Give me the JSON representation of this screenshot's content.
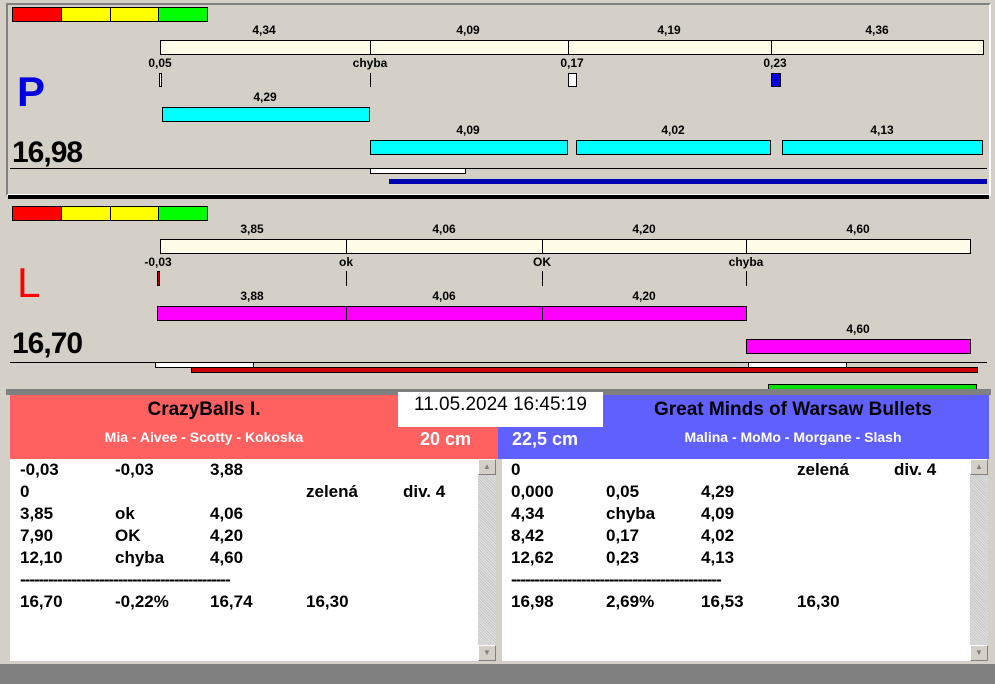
{
  "colors": {
    "red": "#ff0000",
    "yellow": "#ffff00",
    "green": "#00ff00",
    "cyan": "#00ffff",
    "magenta": "#ff00ff",
    "blue": "#0000c0"
  },
  "p": {
    "letter": "P",
    "total": "16,98",
    "top": [
      "4,34",
      "4,09",
      "4,19",
      "4,36"
    ],
    "marks": [
      "0,05",
      "chyba",
      "0,17",
      "0,23"
    ],
    "row1": [
      "4,29"
    ],
    "row2": [
      "4,09",
      "4,02",
      "4,13"
    ]
  },
  "l": {
    "letter": "L",
    "total": "16,70",
    "top": [
      "3,85",
      "4,06",
      "4,20",
      "4,60"
    ],
    "marks": [
      "-0,03",
      "ok",
      "OK",
      "chyba"
    ],
    "row1": [
      "3,88",
      "4,06",
      "4,20"
    ],
    "row2": [
      "4,60"
    ]
  },
  "datetime": "11.05.2024 16:45:19",
  "left_team": {
    "name": "CrazyBalls I.",
    "players": "Mia - Aivee - Scotty - Kokoska",
    "distance": "20 cm",
    "rows": [
      [
        "-0,03",
        "-0,03",
        "3,88",
        "",
        ""
      ],
      [
        "0",
        "",
        "",
        "zelená",
        "div. 4"
      ],
      [
        "3,85",
        "ok",
        "4,06",
        "",
        ""
      ],
      [
        "7,90",
        "OK",
        "4,20",
        "",
        ""
      ],
      [
        "12,10",
        "chyba",
        "4,60",
        "",
        ""
      ],
      [
        "---------------------------------------------",
        "",
        "",
        "",
        ""
      ],
      [
        "16,70",
        "-0,22%",
        "16,74",
        "16,30",
        ""
      ]
    ]
  },
  "right_team": {
    "name": "Great Minds of Warsaw Bullets",
    "players": "Malina - MoMo - Morgane - Slash",
    "distance": "22,5 cm",
    "rows": [
      [
        "0",
        "",
        "",
        "zelená",
        "div. 4"
      ],
      [
        "0,000",
        "0,05",
        "4,29",
        "",
        ""
      ],
      [
        "4,34",
        "chyba",
        "4,09",
        "",
        ""
      ],
      [
        "8,42",
        "0,17",
        "4,02",
        "",
        ""
      ],
      [
        "12,62",
        "0,23",
        "4,13",
        "",
        ""
      ],
      [
        "---------------------------------------------",
        "",
        "",
        "",
        ""
      ],
      [
        "16,98",
        "2,69%",
        "16,53",
        "16,30",
        ""
      ]
    ]
  }
}
